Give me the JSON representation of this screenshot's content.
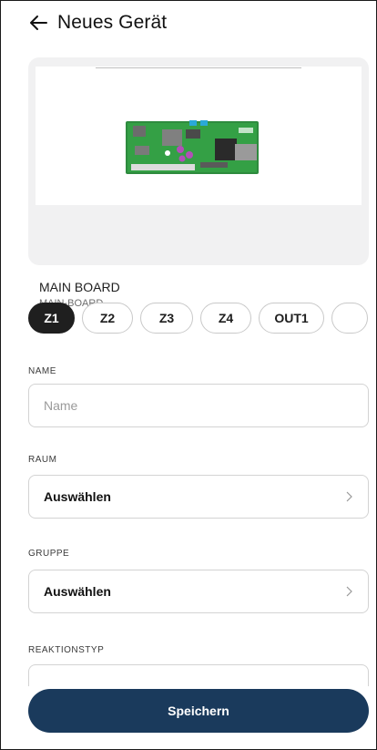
{
  "header": {
    "back_icon": "arrow-left-icon",
    "title": "Neues Gerät"
  },
  "device": {
    "name": "MAIN BOARD",
    "code": "MAIN-BOARD",
    "image": "circuit-board-image"
  },
  "tabs": [
    {
      "label": "Z1",
      "active": true
    },
    {
      "label": "Z2"
    },
    {
      "label": "Z3"
    },
    {
      "label": "Z4"
    },
    {
      "label": "OUT1"
    },
    {
      "label": ""
    }
  ],
  "form": {
    "name": {
      "label": "NAME",
      "placeholder": "Name",
      "value": ""
    },
    "room": {
      "label": "RAUM",
      "value": "Auswählen"
    },
    "group": {
      "label": "GRUPPE",
      "value": "Auswählen"
    },
    "reaction": {
      "label": "REAKTIONSTYP"
    }
  },
  "actions": {
    "save_label": "Speichern"
  },
  "colors": {
    "primary": "#1a3a5c",
    "active_tab": "#1f1f1f",
    "card_bg": "#f1f1f2"
  }
}
